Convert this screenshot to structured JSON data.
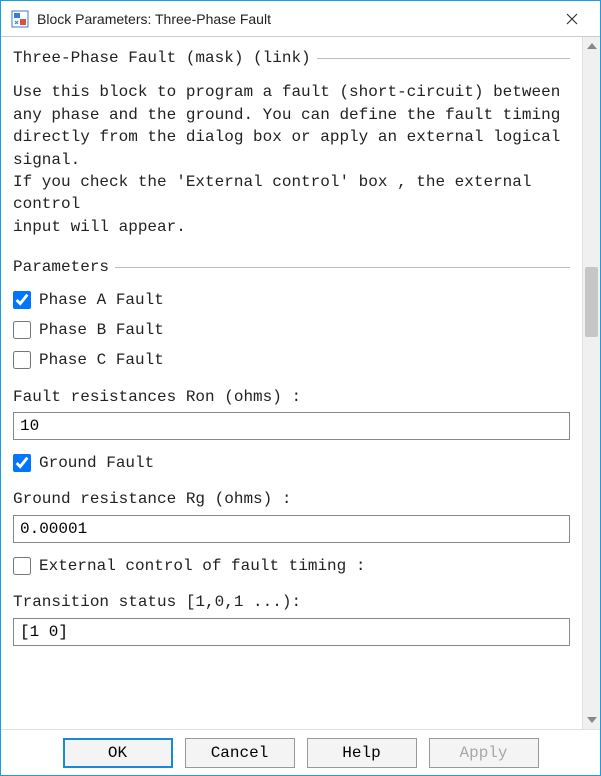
{
  "window": {
    "title": "Block Parameters: Three-Phase Fault"
  },
  "mask": {
    "legend": "Three-Phase Fault (mask) (link)",
    "description": "Use this block to program a fault (short-circuit) between\nany phase and the ground. You can define the fault timing\ndirectly from the dialog box or apply an external logical signal.\nIf you check the 'External control' box , the external control\ninput will appear."
  },
  "params": {
    "legend": "Parameters",
    "phaseA": {
      "label": "Phase A Fault",
      "checked": true
    },
    "phaseB": {
      "label": "Phase B Fault",
      "checked": false
    },
    "phaseC": {
      "label": "Phase C Fault",
      "checked": false
    },
    "faultResistanceLabel": "Fault resistances  Ron (ohms) :",
    "faultResistanceValue": "10",
    "groundFault": {
      "label": "Ground Fault",
      "checked": true
    },
    "groundResistanceLabel": "Ground resistance Rg (ohms) :",
    "groundResistanceValue": "0.00001",
    "externalControl": {
      "label": "External control of fault timing :",
      "checked": false
    },
    "transitionStatusLabel": "Transition status [1,0,1 ...):",
    "transitionStatusValue": "[1 0]"
  },
  "buttons": {
    "ok": "OK",
    "cancel": "Cancel",
    "help": "Help",
    "apply": "Apply"
  }
}
